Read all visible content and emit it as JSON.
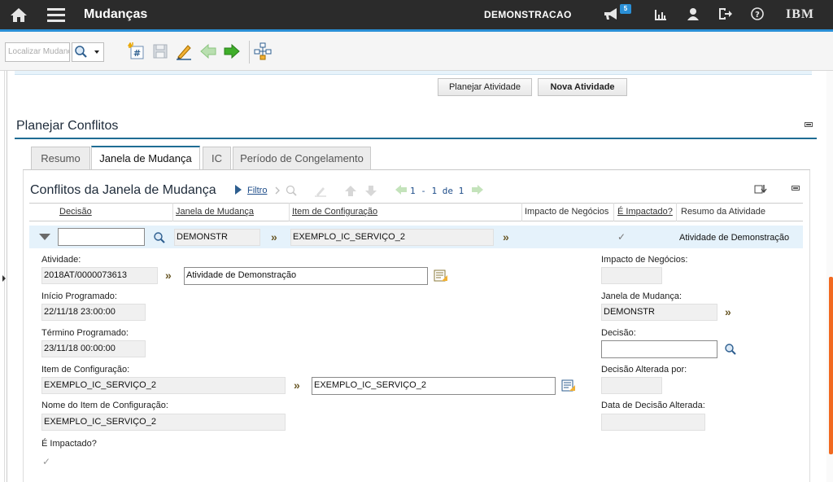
{
  "header": {
    "app_title": "Mudanças",
    "organization": "DEMONSTRACAO",
    "notifications_count": "5",
    "brand": "IBM"
  },
  "toolbar": {
    "search_placeholder": "Localizar Mudança"
  },
  "actions": {
    "plan_activity": "Planejar Atividade",
    "new_activity": "Nova Atividade"
  },
  "section": {
    "title": "Planejar Conflitos"
  },
  "tabs": [
    {
      "label": "Resumo"
    },
    {
      "label": "Janela de Mudança"
    },
    {
      "label": "IC"
    },
    {
      "label": "Período de Congelamento"
    }
  ],
  "table": {
    "title": "Conflitos da Janela de Mudança",
    "filter_label": "Filtro",
    "pager": "1 - 1 de 1",
    "columns": [
      "Decisão",
      "Janela de Mudança",
      "Item de Configuração",
      "Impacto de Negócios",
      "É Impactado?",
      "Resumo da Atividade"
    ],
    "row": {
      "decision": "",
      "change_window": "DEMONSTR",
      "config_item": "EXEMPLO_IC_SERVIÇO_2",
      "business_impact": "",
      "is_impacted": "✓",
      "activity_summary": "Atividade de Demonstração"
    }
  },
  "details": {
    "activity_label": "Atividade:",
    "activity_id": "2018AT/0000073613",
    "activity_desc": "Atividade de Demonstração",
    "start_label": "Início Programado:",
    "start_value": "22/11/18 23:00:00",
    "end_label": "Término Programado:",
    "end_value": "23/11/18 00:00:00",
    "ci_label": "Item de Configuração:",
    "ci_value": "EXEMPLO_IC_SERVIÇO_2",
    "ci_desc": "EXEMPLO_IC_SERVIÇO_2",
    "ci_name_label": "Nome do Item de Configuração:",
    "ci_name_value": "EXEMPLO_IC_SERVIÇO_2",
    "impacted_label": "É Impactado?",
    "impacted_value": "✓",
    "business_impact_label": "Impacto de Negócios:",
    "business_impact_value": "",
    "window_label": "Janela de Mudança:",
    "window_value": "DEMONSTR",
    "decision_label": "Decisão:",
    "decision_value": "",
    "decision_changed_by_label": "Decisão Alterada por:",
    "decision_changed_by_value": "",
    "decision_date_label": "Data de Decisão Alterada:",
    "decision_date_value": ""
  },
  "colors": {
    "topbar": "#2b2b2b",
    "accent": "#2a8fd6",
    "selected_row": "#e5f2fb",
    "scroll_thumb": "#f26a21"
  }
}
